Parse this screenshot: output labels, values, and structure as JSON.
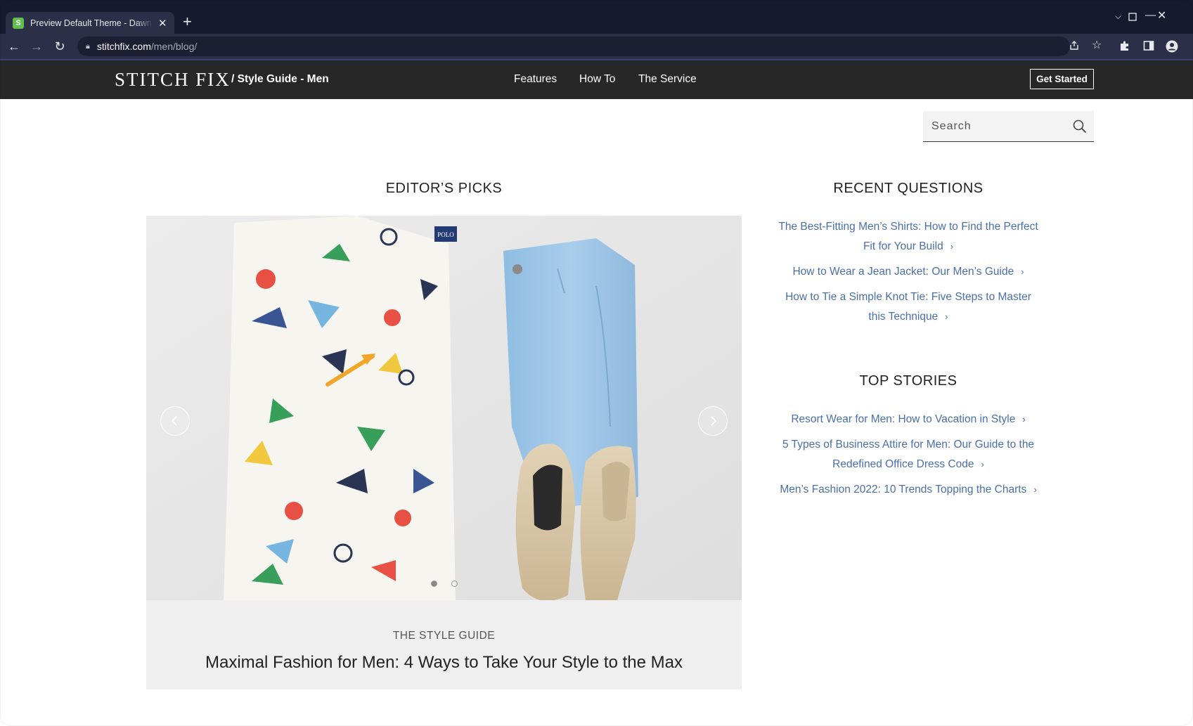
{
  "browser": {
    "tab_title": "Preview Default Theme - Dawn E",
    "favicon_letter": "S",
    "url_host": "stitchfix.com",
    "url_path": "/men/blog/"
  },
  "header": {
    "logo": "STITCH FIX",
    "section": "/ Style Guide - Men",
    "nav": [
      "Features",
      "How To",
      "The Service"
    ],
    "cta": "Get Started"
  },
  "search": {
    "placeholder": "Search"
  },
  "editors_picks": {
    "heading": "EDITOR’S PICKS",
    "category": "THE STYLE GUIDE",
    "title": "Maximal Fashion for Men: 4 Ways to Take Your Style to the Max",
    "shirt_label": "POLO"
  },
  "recent_questions": {
    "heading": "RECENT QUESTIONS",
    "items": [
      "The Best-Fitting Men’s Shirts: How to Find the Perfect Fit for Your Build",
      "How to Wear a Jean Jacket: Our Men’s Guide",
      "How to Tie a Simple Knot Tie: Five Steps to Master this Technique"
    ]
  },
  "top_stories": {
    "heading": "TOP STORIES",
    "items": [
      "Resort Wear for Men: How to Vacation in Style",
      "5 Types of Business Attire for Men: Our Guide to the Redefined Office Dress Code",
      "Men’s Fashion 2022: 10 Trends Topping the Charts"
    ]
  },
  "colors": {
    "header_bg": "#272727",
    "link": "#4a6fa8",
    "browser_tabbar": "#161a2e",
    "browser_toolbar": "#2b2f47"
  }
}
